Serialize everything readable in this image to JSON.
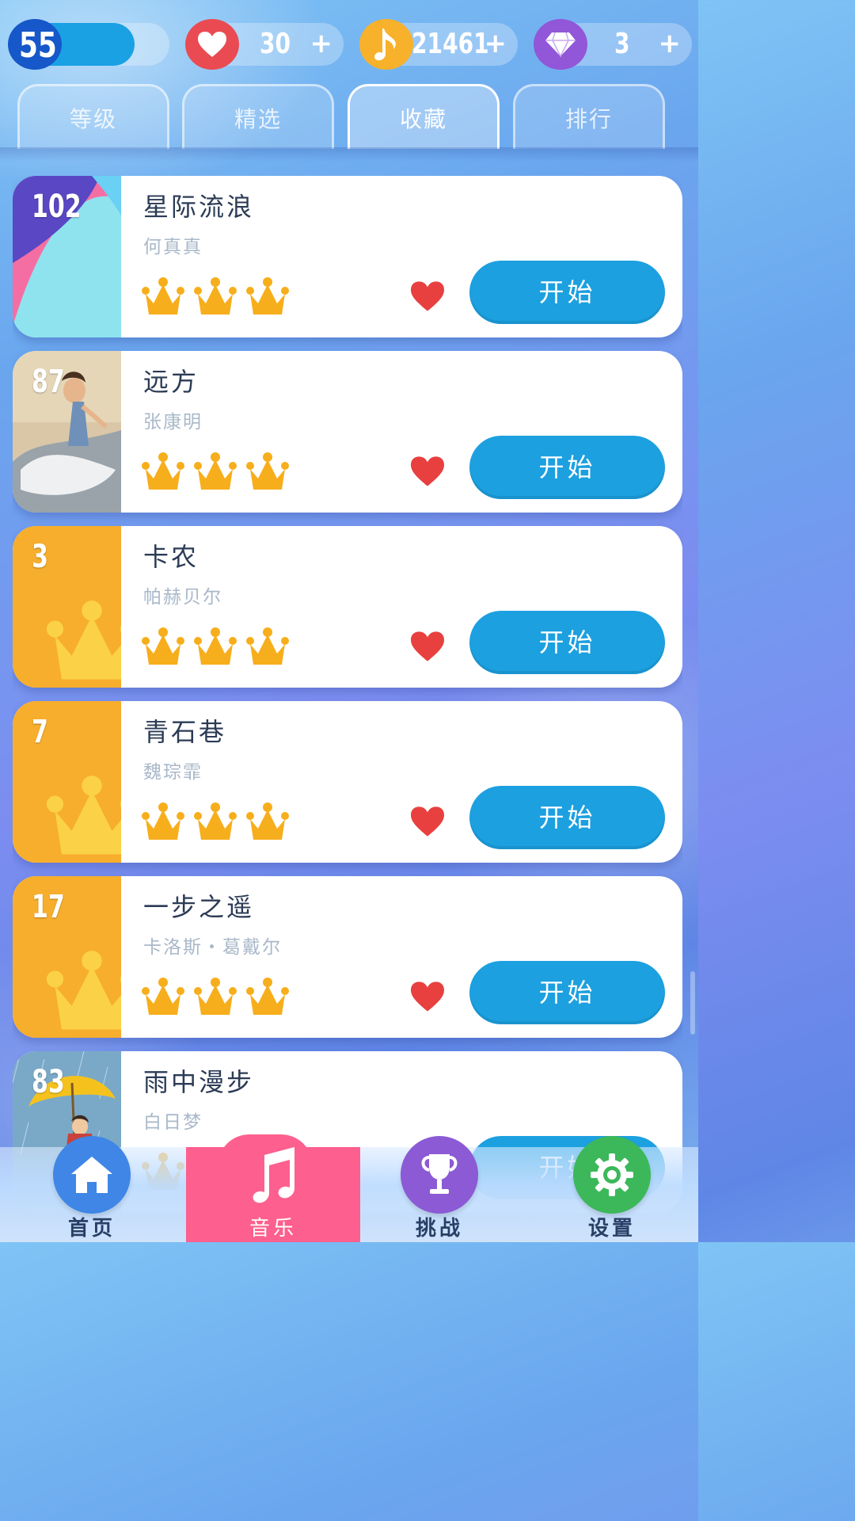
{
  "stats": {
    "level": "55",
    "lives": "30",
    "notes": "21461",
    "gems": "3",
    "plus": "+"
  },
  "tabs": [
    {
      "label": "等级",
      "active": false
    },
    {
      "label": "精选",
      "active": false
    },
    {
      "label": "收藏",
      "active": true
    },
    {
      "label": "排行",
      "active": false
    }
  ],
  "songs": [
    {
      "rank": "102",
      "title": "星际流浪",
      "artist": "何真真",
      "crowns": 3,
      "favorite": true,
      "button": "开始",
      "thumb": "abstract"
    },
    {
      "rank": "87",
      "title": "远方",
      "artist": "张康明",
      "crowns": 3,
      "favorite": true,
      "button": "开始",
      "thumb": "dancer"
    },
    {
      "rank": "3",
      "title": "卡农",
      "artist": "帕赫贝尔",
      "crowns": 3,
      "favorite": true,
      "button": "开始",
      "thumb": "crown"
    },
    {
      "rank": "7",
      "title": "青石巷",
      "artist": "魏琮霏",
      "crowns": 3,
      "favorite": true,
      "button": "开始",
      "thumb": "crown"
    },
    {
      "rank": "17",
      "title": "一步之遥",
      "artist": "卡洛斯・葛戴尔",
      "crowns": 3,
      "favorite": true,
      "button": "开始",
      "thumb": "crown"
    },
    {
      "rank": "83",
      "title": "雨中漫步",
      "artist": "白日梦",
      "crowns": 3,
      "favorite": true,
      "button": "开始",
      "thumb": "umbrella"
    }
  ],
  "nav": {
    "home": "首页",
    "music": "音乐",
    "challenge": "挑战",
    "settings": "设置"
  },
  "colors": {
    "start_button": "#1ca0e0",
    "crown": "#f7ae1c",
    "heart": "#e8403f",
    "active_nav": "#fd5f8e"
  }
}
